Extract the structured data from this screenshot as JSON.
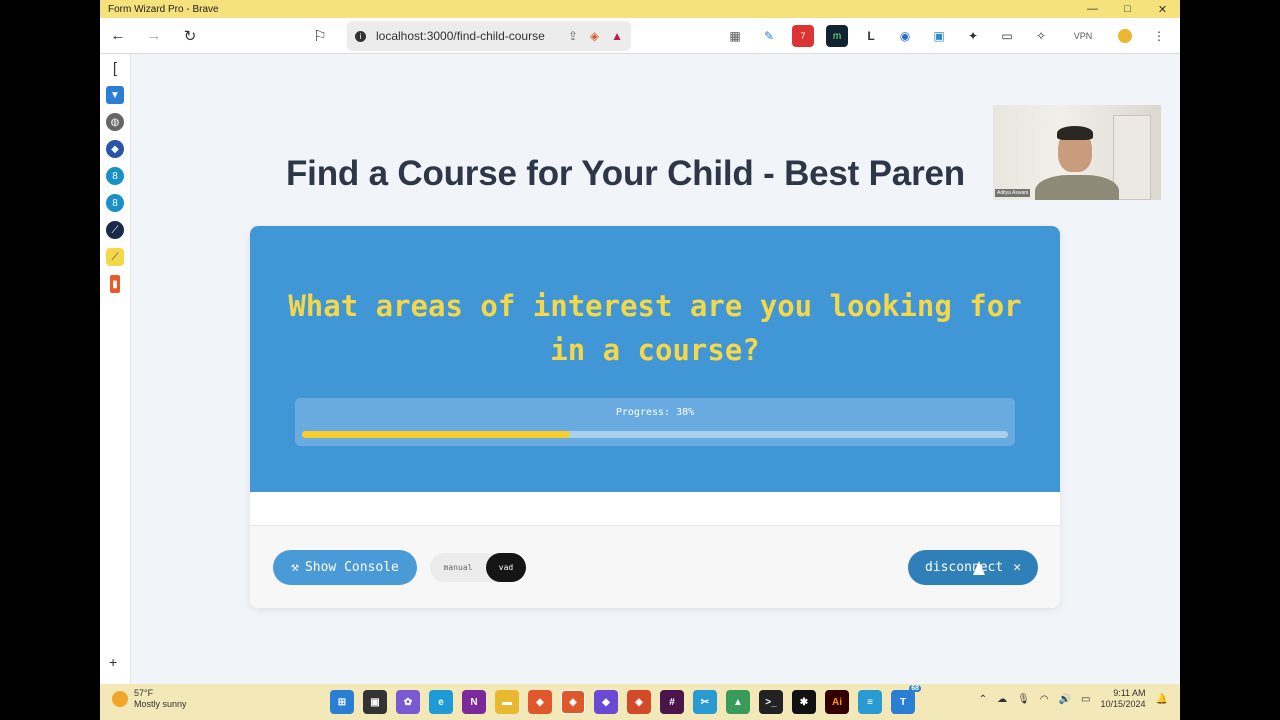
{
  "window": {
    "title": "Form Wizard Pro - Brave",
    "controls": [
      "—",
      "□",
      "✕"
    ]
  },
  "browser": {
    "url": "localhost:3000/find-child-course",
    "vpn_label": "VPN"
  },
  "page": {
    "heading": "Find a Course for Your Child - Best Paren",
    "question": "What areas of interest are you looking for in a course?",
    "progress_label": "Progress: 38%",
    "progress_value": 38,
    "show_console_label": "Show Console",
    "mode_manual": "manual",
    "mode_vad": "vad",
    "mode_selected": "vad",
    "disconnect_label": "disconnect",
    "disconnect_icon": "✕"
  },
  "video": {
    "participant_name": "Aditya Aswani"
  },
  "taskbar": {
    "temperature": "57°F",
    "weather": "Mostly sunny",
    "time": "9:11 AM",
    "date": "10/15/2024",
    "badge_count": "68"
  },
  "colors": {
    "accent": "#4196d6",
    "question_text": "#f5d84a",
    "progress_fill": "#f5cd2c",
    "disconnect": "#2f7fb9"
  }
}
